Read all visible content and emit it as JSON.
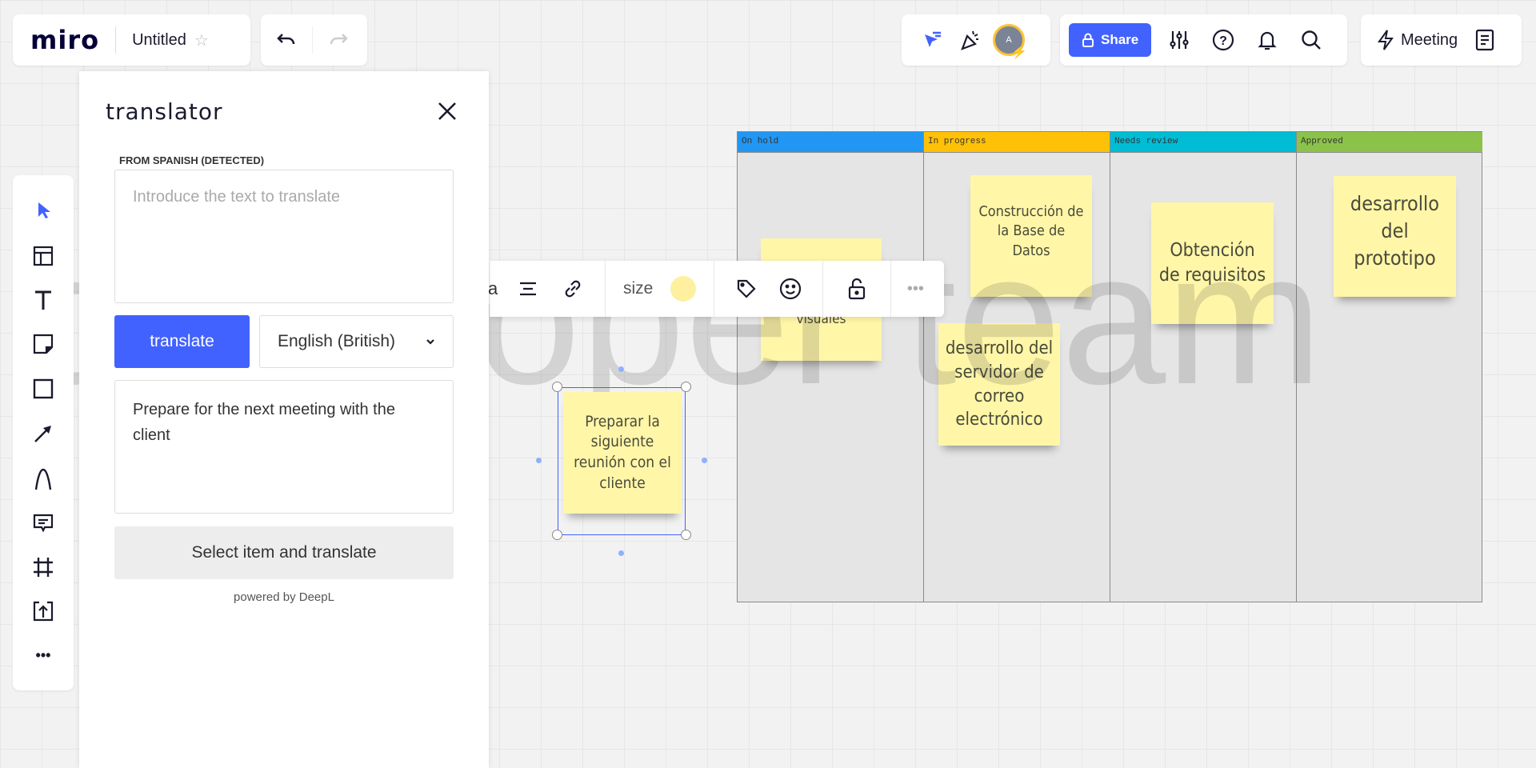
{
  "header": {
    "logo": "miro",
    "board_title": "Untitled",
    "share_label": "Share",
    "meeting_label": "Meeting",
    "icons": [
      "star-icon",
      "undo-icon",
      "redo-icon",
      "cursor-follow-icon",
      "celebrate-icon",
      "avatar",
      "lock-icon",
      "settings-sliders-icon",
      "help-icon",
      "bell-icon",
      "search-icon",
      "lightning-icon",
      "notes-icon"
    ],
    "avatar_initial": "A",
    "accent": "#4262ff"
  },
  "translator": {
    "title": "translator",
    "from_label": "FROM SPANISH (DETECTED)",
    "input_placeholder": "Introduce the text to translate",
    "input_value": "",
    "translate_label": "translate",
    "language": "English (British)",
    "output": "Prepare for the next meeting with the client",
    "select_label": "Select item and translate",
    "powered": "powered by DeepL"
  },
  "toolbar": {
    "tools": [
      "select",
      "templates",
      "text",
      "sticky-note",
      "shape",
      "arrow",
      "pen",
      "comment",
      "frame",
      "upload",
      "more"
    ]
  },
  "context_toolbar": {
    "font_fragment": "a",
    "size_label": "size",
    "color": "#fff0a0"
  },
  "board": {
    "watermark": "developer team",
    "columns": [
      {
        "title": "On hold",
        "color": "#2196f3"
      },
      {
        "title": "In progress",
        "color": "#ffc107"
      },
      {
        "title": "Needs review",
        "color": "#00bcd4"
      },
      {
        "title": "Approved",
        "color": "#8bc34a"
      }
    ],
    "stickies": {
      "onhold": "visuales",
      "db": "Construcción de la Base de Datos",
      "mail": "desarrollo del servidor de correo electrónico",
      "req": "Obtención de requisitos",
      "proto": "desarrollo del prototipo",
      "selected": "Preparar la siguiente reunión con el cliente"
    }
  }
}
